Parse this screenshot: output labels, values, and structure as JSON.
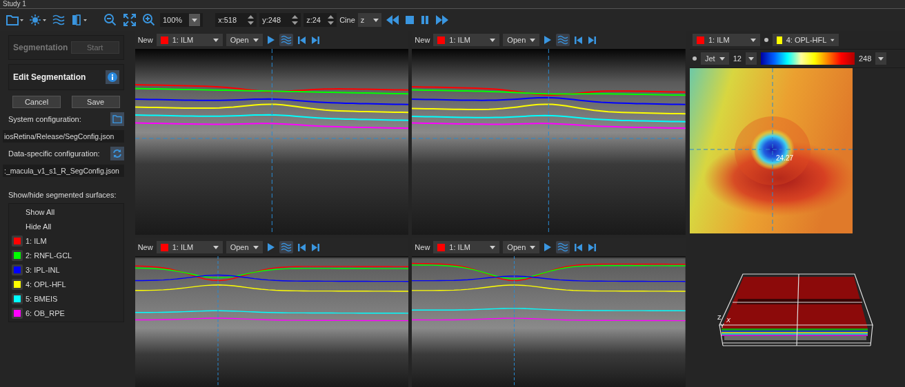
{
  "window": {
    "title": "Study 1"
  },
  "toolbar": {
    "zoom": "100%",
    "x": "x:518",
    "y": "y:248",
    "z": "z:24",
    "cine_label": "Cine",
    "cine_axis": "z"
  },
  "segmentation": {
    "title": "Segmentation",
    "start_button": "Start",
    "start_disabled": true
  },
  "edit": {
    "title": "Edit Segmentation",
    "cancel": "Cancel",
    "save": "Save",
    "system_label": "System configuration:",
    "system_path": "iosRetina/Release/SegConfig.json",
    "data_label": "Data-specific configuration:",
    "data_path": ":_macula_v1_s1_R_SegConfig.json"
  },
  "surfaces": {
    "label": "Show/hide segmented surfaces:",
    "actions": [
      "Show All",
      "Hide All"
    ],
    "items": [
      {
        "name": "1: ILM",
        "color": "#ff0000"
      },
      {
        "name": "2: RNFL-GCL",
        "color": "#00ff00"
      },
      {
        "name": "3: IPL-INL",
        "color": "#0000ff"
      },
      {
        "name": "4: OPL-HFL",
        "color": "#ffff00"
      },
      {
        "name": "5: BMEIS",
        "color": "#00ffff"
      },
      {
        "name": "6: OB_RPE",
        "color": "#ff00ff"
      }
    ]
  },
  "viewers": [
    {
      "new": "New",
      "surface": "1: ILM",
      "color": "#ff0000",
      "open": "Open"
    },
    {
      "new": "New",
      "surface": "1: ILM",
      "color": "#ff0000",
      "open": "Open"
    },
    {
      "new": "New",
      "surface": "1: ILM",
      "color": "#ff0000",
      "open": "Open"
    },
    {
      "new": "New",
      "surface": "1: ILM",
      "color": "#ff0000",
      "open": "Open"
    }
  ],
  "thickness_map": {
    "surfaces": [
      {
        "name": "1: ILM",
        "color": "#ff0000"
      },
      {
        "name": "4: OPL-HFL",
        "color": "#ffff00"
      }
    ],
    "colormap": "Jet",
    "min": "12",
    "max": "248",
    "reading": "24.27"
  },
  "view_3d": {
    "axes": [
      "Z",
      "X",
      "Y"
    ]
  }
}
